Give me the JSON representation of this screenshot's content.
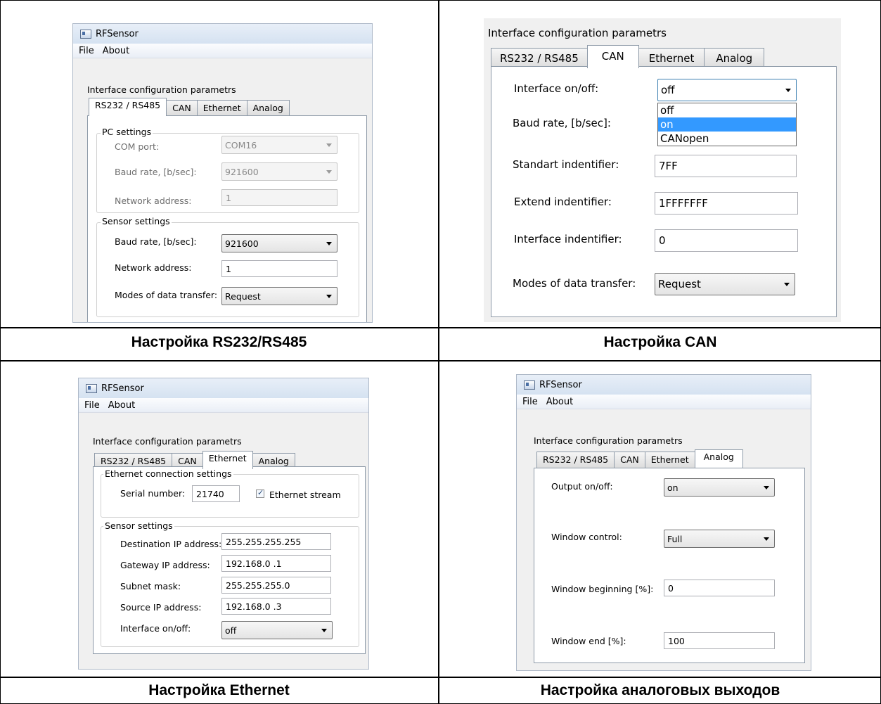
{
  "captions": {
    "rs": "Настройка RS232/RS485",
    "can": "Настройка CAN",
    "eth": "Настройка Ethernet",
    "analog": "Настройка аналоговых выходов"
  },
  "app": {
    "title": "RFSensor",
    "menu": [
      "File",
      "About"
    ]
  },
  "section_title": "Interface configuration parametrs",
  "tabs": [
    "RS232 / RS485",
    "CAN",
    "Ethernet",
    "Analog"
  ],
  "rs": {
    "pc_group": "PC settings",
    "com_label": "COM port:",
    "com_value": "COM16",
    "pc_baud_label": "Baud rate, [b/sec]:",
    "pc_baud_value": "921600",
    "pc_addr_label": "Network address:",
    "pc_addr_value": "1",
    "sensor_group": "Sensor settings",
    "baud_label": "Baud rate, [b/sec]:",
    "baud_value": "921600",
    "addr_label": "Network address:",
    "addr_value": "1",
    "modes_label": "Modes of data transfer:",
    "modes_value": "Request"
  },
  "can": {
    "iface_label": "Interface on/off:",
    "iface_value": "off",
    "dropdown_options": [
      "off",
      "on",
      "CANopen"
    ],
    "baud_label": "Baud rate, [b/sec]:",
    "std_label": "Standart indentifier:",
    "std_value": "7FF",
    "ext_label": "Extend indentifier:",
    "ext_value": "1FFFFFFF",
    "iid_label": "Interface indentifier:",
    "iid_value": "0",
    "modes_label": "Modes of data transfer:",
    "modes_value": "Request"
  },
  "eth": {
    "conn_group": "Ethernet connection settings",
    "serial_label": "Serial number:",
    "serial_value": "21740",
    "stream_label": "Ethernet stream",
    "sensor_group": "Sensor settings",
    "dest_label": "Destination IP address:",
    "dest_value": "255.255.255.255",
    "gw_label": "Gateway IP address:",
    "gw_value": "192.168.0 .1",
    "mask_label": "Subnet mask:",
    "mask_value": "255.255.255.0",
    "src_label": "Source IP address:",
    "src_value": "192.168.0 .3",
    "iface_label": "Interface on/off:",
    "iface_value": "off"
  },
  "analog": {
    "out_label": "Output on/off:",
    "out_value": "on",
    "win_label": "Window control:",
    "win_value": "Full",
    "begin_label": "Window beginning [%]:",
    "begin_value": "0",
    "end_label": "Window end [%]:",
    "end_value": "100"
  },
  "colors": {
    "dropdown_highlight": "#3399ff",
    "titlebar": "#d5e2f1"
  },
  "icons": [
    "app-window-icon",
    "chevron-down-icon",
    "checkbox-checked-icon"
  ]
}
